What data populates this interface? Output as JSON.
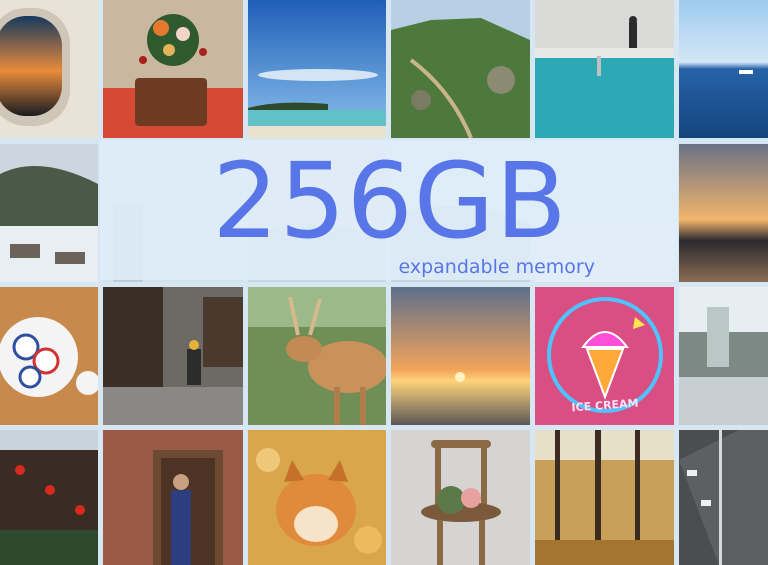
{
  "banner": {
    "headline": "256GB",
    "subline": "expandable memory"
  },
  "photos": {
    "neon_sign_text": "ICE CREAM"
  },
  "colors": {
    "headline": "#5876e8",
    "background": "#d6e6f3",
    "neon_pink": "#ff4fd8",
    "neon_blue": "#4fc3ff"
  }
}
